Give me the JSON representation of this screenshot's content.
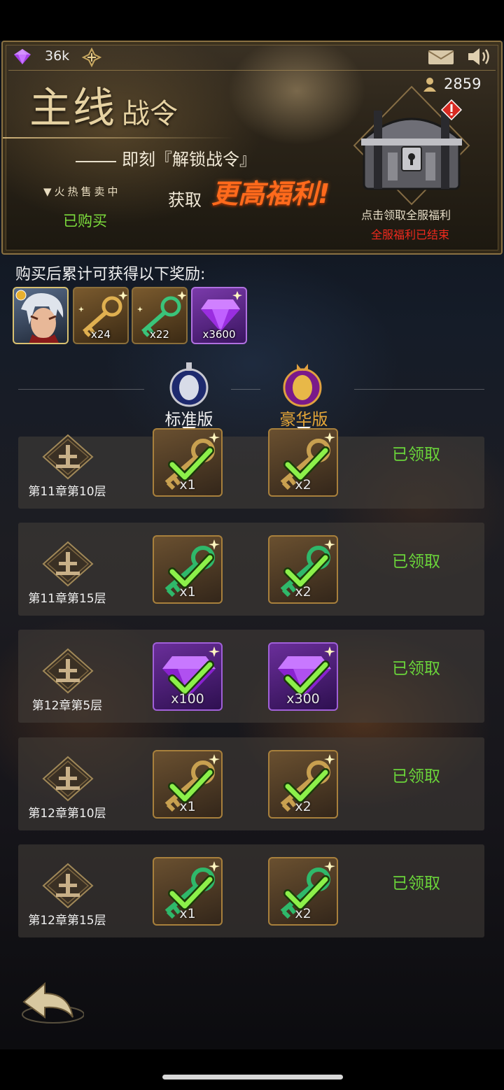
{
  "header": {
    "gems": "36k",
    "player_count": "2859"
  },
  "banner": {
    "title_main": "主线",
    "title_sub": "战令",
    "promo_unlock": "即刻『解锁战令』",
    "promo_hot": "▼火热售卖中",
    "promo_gain": "获取",
    "promo_big": "更高福利!",
    "status": "已购买",
    "claim_all": "点击领取全服福利",
    "claim_ended": "全服福利已结束"
  },
  "rewards": {
    "title": "购买后累计可获得以下奖励:",
    "items": [
      {
        "type": "hero",
        "qty": ""
      },
      {
        "type": "gold-key",
        "qty": "x24"
      },
      {
        "type": "green-key",
        "qty": "x22"
      },
      {
        "type": "purple-gem",
        "qty": "x3600"
      }
    ]
  },
  "tiers": {
    "standard": "标准版",
    "deluxe": "豪华版"
  },
  "rows": [
    {
      "label": "第11章第10层",
      "std_type": "gold-key",
      "std_qty": "x1",
      "dlx_type": "gold-key",
      "dlx_qty": "x2",
      "status": "已领取"
    },
    {
      "label": "第11章第15层",
      "std_type": "green-key",
      "std_qty": "x1",
      "dlx_type": "green-key",
      "dlx_qty": "x2",
      "status": "已领取"
    },
    {
      "label": "第12章第5层",
      "std_type": "purple-gem",
      "std_qty": "x100",
      "dlx_type": "purple-gem",
      "dlx_qty": "x300",
      "status": "已领取"
    },
    {
      "label": "第12章第10层",
      "std_type": "gold-key",
      "std_qty": "x1",
      "dlx_type": "gold-key",
      "dlx_qty": "x2",
      "status": "已领取"
    },
    {
      "label": "第12章第15层",
      "std_type": "green-key",
      "std_qty": "x1",
      "dlx_type": "green-key",
      "dlx_qty": "x2",
      "status": "已领取"
    }
  ],
  "colors": {
    "accent_green": "#6ad43a",
    "accent_orange": "#ff6a1c",
    "alert_red": "#f02a1e",
    "gold_border": "#a8803c"
  }
}
